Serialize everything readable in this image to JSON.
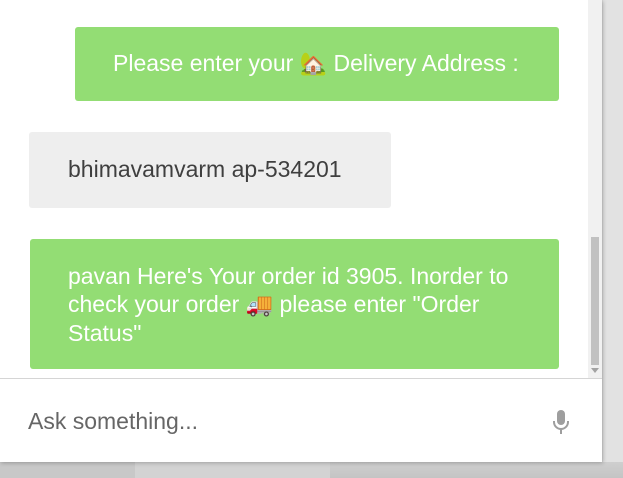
{
  "messages": [
    {
      "sender": "bot",
      "text_before": "Please enter your ",
      "emoji": "🏡",
      "text_after": " Delivery Address :"
    },
    {
      "sender": "user",
      "text": "bhimavamvarm ap-534201"
    },
    {
      "sender": "bot",
      "text_before": "pavan Here's Your order id 3905. Inorder to check your order ",
      "emoji": "🚚",
      "text_after": " please enter \"Order Status\""
    }
  ],
  "input": {
    "placeholder": "Ask something..."
  },
  "icons": {
    "send_voice": "microphone-icon",
    "house": "house-with-garden-icon",
    "truck": "delivery-truck-icon"
  },
  "colors": {
    "bot_bubble": "#93dd74",
    "user_bubble": "#eeeeee",
    "mic": "#9e9e9e"
  }
}
